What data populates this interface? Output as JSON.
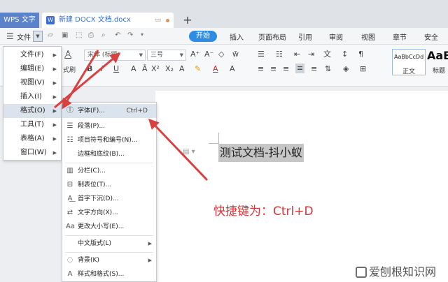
{
  "titlebar": {
    "app_tab": "WPS 文字",
    "doc_tab": "新建 DOCX 文档.docx",
    "new_tab": "+"
  },
  "ribbon": {
    "file_label": "文件",
    "tabs": [
      "开始",
      "插入",
      "页面布局",
      "引用",
      "审阅",
      "视图",
      "章节",
      "安全"
    ],
    "active_tab": "开始"
  },
  "toolbar": {
    "font_name": "宋体 (标题)",
    "font_size": "三号",
    "format_brush": "式刷",
    "style_normal_sample": "AaBbCcDd",
    "style_normal": "正文",
    "style_heading_sample": "AaB",
    "style_heading": "标题"
  },
  "file_menu": {
    "items": [
      {
        "label": "文件(F)",
        "has_sub": true
      },
      {
        "label": "编辑(E)",
        "has_sub": true
      },
      {
        "label": "视图(V)",
        "has_sub": true
      },
      {
        "label": "插入(I)",
        "has_sub": true
      },
      {
        "label": "格式(O)",
        "has_sub": true
      },
      {
        "label": "工具(T)",
        "has_sub": true
      },
      {
        "label": "表格(A)",
        "has_sub": true
      },
      {
        "label": "窗口(W)",
        "has_sub": true
      }
    ],
    "highlighted": "格式(O)"
  },
  "format_menu": {
    "items": [
      {
        "label": "字体(F)...",
        "shortcut": "Ctrl+D",
        "icon": "font-icon"
      },
      {
        "label": "段落(P)...",
        "shortcut": "",
        "icon": "paragraph-icon"
      },
      {
        "label": "项目符号和编号(N)...",
        "shortcut": "",
        "icon": "bullet-list-icon"
      },
      {
        "label": "边框和底纹(B)...",
        "shortcut": "",
        "icon": ""
      },
      {
        "label": "分栏(C)...",
        "shortcut": "",
        "icon": "columns-icon"
      },
      {
        "label": "制表位(T)...",
        "shortcut": "",
        "icon": "tab-stop-icon"
      },
      {
        "label": "首字下沉(D)...",
        "shortcut": "",
        "icon": "drop-cap-icon"
      },
      {
        "label": "文字方向(X)...",
        "shortcut": "",
        "icon": "text-direction-icon"
      },
      {
        "label": "更改大小写(E)...",
        "shortcut": "",
        "icon": "change-case-icon"
      },
      {
        "label": "中文版式(L)",
        "shortcut": "",
        "icon": ""
      },
      {
        "label": "背景(K)",
        "shortcut": "",
        "icon": "background-icon"
      },
      {
        "label": "样式和格式(S)...",
        "shortcut": "",
        "icon": "styles-icon"
      }
    ]
  },
  "document": {
    "selected_text": "测试文档-抖小蚁",
    "annotation": "快捷键为：Ctrl+D"
  },
  "watermark": "爱刨根知识网",
  "colors": {
    "accent": "#2e8ce6",
    "annotation_red": "#d6353a",
    "arrow_red": "#d9413f"
  }
}
